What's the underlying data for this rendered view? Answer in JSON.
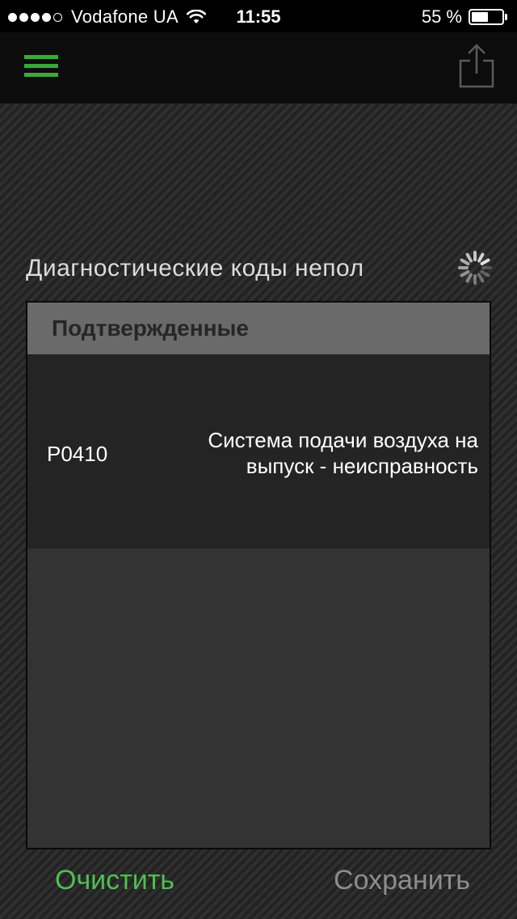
{
  "status_bar": {
    "signal_bars_filled": 4,
    "signal_bars_total": 5,
    "carrier": "Vodafone UA",
    "time": "11:55",
    "battery_percent": "55 %",
    "battery_level": 0.55,
    "icons": [
      "wifi-icon",
      "battery-icon"
    ]
  },
  "nav_bar": {
    "menu_icon": "hamburger-menu-icon",
    "share_icon": "share-icon",
    "accent_color": "#3aa93a"
  },
  "section": {
    "title": "Диагностические коды непол",
    "loading_icon": "spinner-icon"
  },
  "panel": {
    "header": "Подтвержденные",
    "codes": [
      {
        "code": "P0410",
        "description": "Система подачи воздуха на выпуск - неисправность"
      }
    ]
  },
  "actions": {
    "clear_label": "Очистить",
    "save_label": "Сохранить",
    "clear_color": "#4fbf4f",
    "save_color": "#8d8d8d"
  }
}
